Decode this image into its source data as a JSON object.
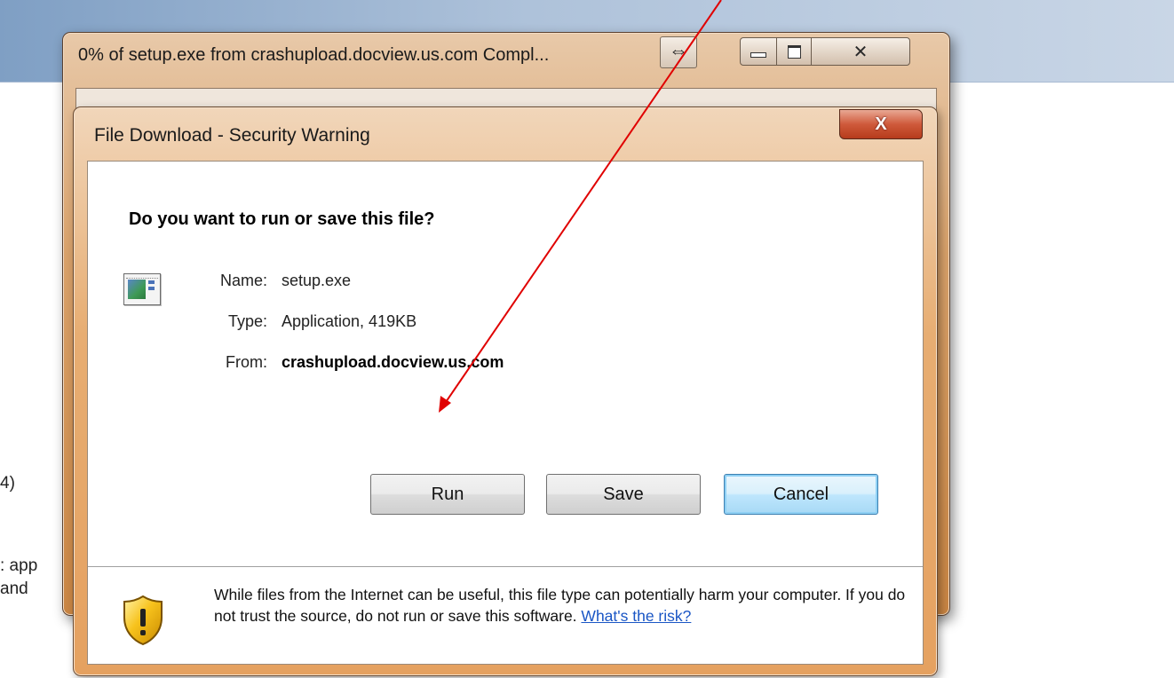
{
  "background_page": {
    "text_line_1": "4)",
    "text_line_2": ": app",
    "text_line_3": "and"
  },
  "progress_window": {
    "title": "0% of setup.exe from crashupload.docview.us.com Compl...",
    "resize_glyph": "⇔",
    "minimize_glyph": "▭",
    "maximize_glyph": "◻",
    "close_glyph": "✕"
  },
  "dialog": {
    "title": "File Download - Security Warning",
    "close_glyph": "X",
    "question": "Do you want to run or save this file?",
    "file_icon": "application-window-icon",
    "name_label": "Name:",
    "name_value": "setup.exe",
    "type_label": "Type:",
    "type_value": "Application, 419KB",
    "from_label": "From:",
    "from_value": "crashupload.docview.us.com",
    "buttons": {
      "run": "Run",
      "save": "Save",
      "cancel": "Cancel"
    },
    "warning_icon": "shield-warning-icon",
    "warning_text": "While files from the Internet can be useful, this file type can potentially harm your computer. If you do not trust the source, do not run or save this software.",
    "risk_link": "What's the risk?"
  },
  "annotation": {
    "arrow_color": "#e00000"
  }
}
